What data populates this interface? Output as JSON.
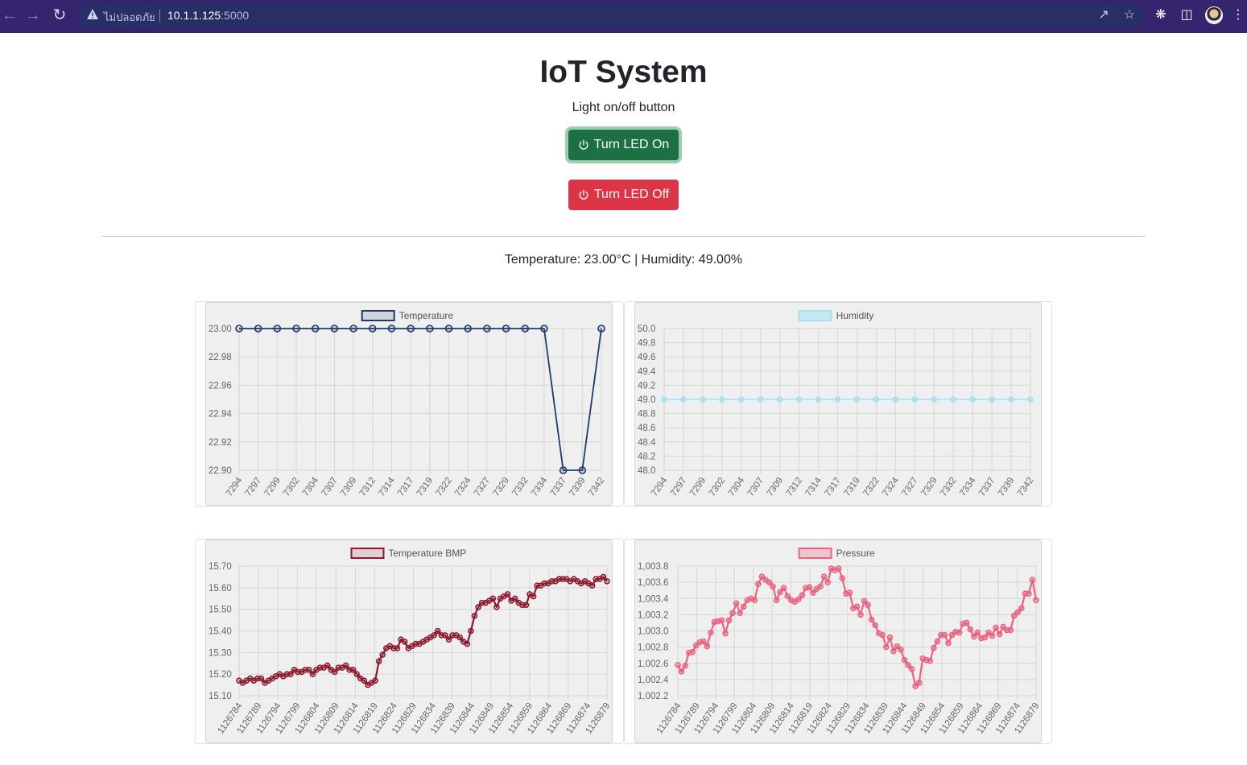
{
  "browser": {
    "security_label": "ไม่ปลอดภัย",
    "url_host": "10.1.1.125",
    "url_port": ":5000"
  },
  "page": {
    "title": "IoT System",
    "subtitle": "Light on/off button",
    "led_on_label": "Turn LED On",
    "led_off_label": "Turn LED Off",
    "readout": "Temperature: 23.00°C | Humidity: 49.00%"
  },
  "colors": {
    "temperature": "#1f3a6e",
    "humidity": "#9ee3f0",
    "temperature_bmp": "#8b1a2e",
    "pressure": "#e9637f"
  },
  "chart_data": [
    {
      "type": "line",
      "series": [
        {
          "name": "Temperature",
          "values": [
            23.0,
            23.0,
            23.0,
            23.0,
            23.0,
            23.0,
            23.0,
            23.0,
            23.0,
            23.0,
            23.0,
            23.0,
            23.0,
            23.0,
            23.0,
            23.0,
            23.0,
            22.9,
            22.9,
            23.0
          ]
        }
      ],
      "x": [
        "7294",
        "7297",
        "7299",
        "7302",
        "7304",
        "7307",
        "7309",
        "7312",
        "7314",
        "7317",
        "7319",
        "7322",
        "7324",
        "7327",
        "7329",
        "7332",
        "7334",
        "7337",
        "7339",
        "7342"
      ],
      "yticks": [
        "23.00",
        "22.98",
        "22.96",
        "22.94",
        "22.92",
        "22.90"
      ],
      "ylim": [
        22.9,
        23.0
      ],
      "legend": "top",
      "grid": true
    },
    {
      "type": "line",
      "series": [
        {
          "name": "Humidity",
          "values": [
            49,
            49,
            49,
            49,
            49,
            49,
            49,
            49,
            49,
            49,
            49,
            49,
            49,
            49,
            49,
            49,
            49,
            49,
            49,
            49
          ]
        }
      ],
      "x": [
        "7294",
        "7297",
        "7299",
        "7302",
        "7304",
        "7307",
        "7309",
        "7312",
        "7314",
        "7317",
        "7319",
        "7322",
        "7324",
        "7327",
        "7329",
        "7332",
        "7334",
        "7337",
        "7339",
        "7342"
      ],
      "yticks": [
        "50.0",
        "49.8",
        "49.6",
        "49.4",
        "49.2",
        "49.0",
        "48.8",
        "48.6",
        "48.4",
        "48.2",
        "48.0"
      ],
      "ylim": [
        48.0,
        50.0
      ],
      "legend": "top",
      "grid": true
    },
    {
      "type": "line",
      "series": [
        {
          "name": "Temperature BMP",
          "values": [
            15.17,
            15.16,
            15.17,
            15.18,
            15.17,
            15.18,
            15.18,
            15.16,
            15.17,
            15.18,
            15.19,
            15.2,
            15.19,
            15.2,
            15.2,
            15.22,
            15.21,
            15.21,
            15.22,
            15.22,
            15.2,
            15.22,
            15.23,
            15.23,
            15.24,
            15.22,
            15.21,
            15.23,
            15.23,
            15.24,
            15.22,
            15.22,
            15.2,
            15.18,
            15.17,
            15.15,
            15.16,
            15.17,
            15.26,
            15.29,
            15.32,
            15.33,
            15.32,
            15.32,
            15.36,
            15.35,
            15.32,
            15.33,
            15.34,
            15.34,
            15.35,
            15.36,
            15.37,
            15.38,
            15.4,
            15.38,
            15.38,
            15.36,
            15.38,
            15.38,
            15.37,
            15.35,
            15.34,
            15.4,
            15.47,
            15.51,
            15.53,
            15.53,
            15.54,
            15.55,
            15.51,
            15.55,
            15.56,
            15.57,
            15.54,
            15.55,
            15.53,
            15.52,
            15.52,
            15.57,
            15.56,
            15.61,
            15.61,
            15.62,
            15.62,
            15.63,
            15.63,
            15.64,
            15.64,
            15.64,
            15.63,
            15.64,
            15.63,
            15.62,
            15.63,
            15.62,
            15.61,
            15.64,
            15.64,
            15.65,
            15.63
          ]
        }
      ],
      "x": [
        "1126784",
        "1126789",
        "1126794",
        "1126799",
        "1126804",
        "1126809",
        "1126814",
        "1126819",
        "1126824",
        "1126829",
        "1126834",
        "1126839",
        "1126844",
        "1126849",
        "1126854",
        "1126859",
        "1126864",
        "1126869",
        "1126874",
        "1126879"
      ],
      "yticks": [
        "15.70",
        "15.60",
        "15.50",
        "15.40",
        "15.30",
        "15.20",
        "15.10"
      ],
      "ylim": [
        15.1,
        15.7
      ],
      "legend": "top",
      "grid": true
    },
    {
      "type": "line",
      "series": [
        {
          "name": "Pressure",
          "values": [
            1002.58,
            1002.5,
            1002.57,
            1002.73,
            1002.74,
            1002.82,
            1002.86,
            1002.87,
            1002.81,
            1002.98,
            1003.11,
            1003.12,
            1003.13,
            1002.97,
            1003.13,
            1003.22,
            1003.34,
            1003.22,
            1003.3,
            1003.38,
            1003.4,
            1003.38,
            1003.58,
            1003.67,
            1003.63,
            1003.6,
            1003.55,
            1003.38,
            1003.48,
            1003.53,
            1003.43,
            1003.38,
            1003.36,
            1003.39,
            1003.44,
            1003.53,
            1003.54,
            1003.47,
            1003.52,
            1003.55,
            1003.67,
            1003.6,
            1003.77,
            1003.75,
            1003.77,
            1003.65,
            1003.46,
            1003.47,
            1003.28,
            1003.3,
            1003.2,
            1003.37,
            1003.32,
            1003.14,
            1003.07,
            1002.97,
            1002.95,
            1002.8,
            1002.92,
            1002.75,
            1002.81,
            1002.77,
            1002.64,
            1002.58,
            1002.53,
            1002.32,
            1002.36,
            1002.66,
            1002.64,
            1002.63,
            1002.79,
            1002.87,
            1002.95,
            1002.95,
            1002.85,
            1002.95,
            1002.99,
            1002.98,
            1003.09,
            1003.1,
            1003.02,
            1002.93,
            1002.98,
            1002.91,
            1002.92,
            1002.98,
            1002.94,
            1003.04,
            1002.96,
            1003.05,
            1003.01,
            1003.01,
            1003.19,
            1003.23,
            1003.28,
            1003.46,
            1003.46,
            1003.63,
            1003.38
          ]
        }
      ],
      "x": [
        "1126784",
        "1126789",
        "1126794",
        "1126799",
        "1126804",
        "1126809",
        "1126814",
        "1126819",
        "1126824",
        "1126829",
        "1126834",
        "1126839",
        "1126844",
        "1126849",
        "1126854",
        "1126859",
        "1126864",
        "1126869",
        "1126874",
        "1126879"
      ],
      "yticks": [
        "1,003.8",
        "1,003.6",
        "1,003.4",
        "1,003.2",
        "1,003.0",
        "1,002.8",
        "1,002.6",
        "1,002.4",
        "1,002.2"
      ],
      "ylim": [
        1002.2,
        1003.8
      ],
      "legend": "top",
      "grid": true
    }
  ]
}
